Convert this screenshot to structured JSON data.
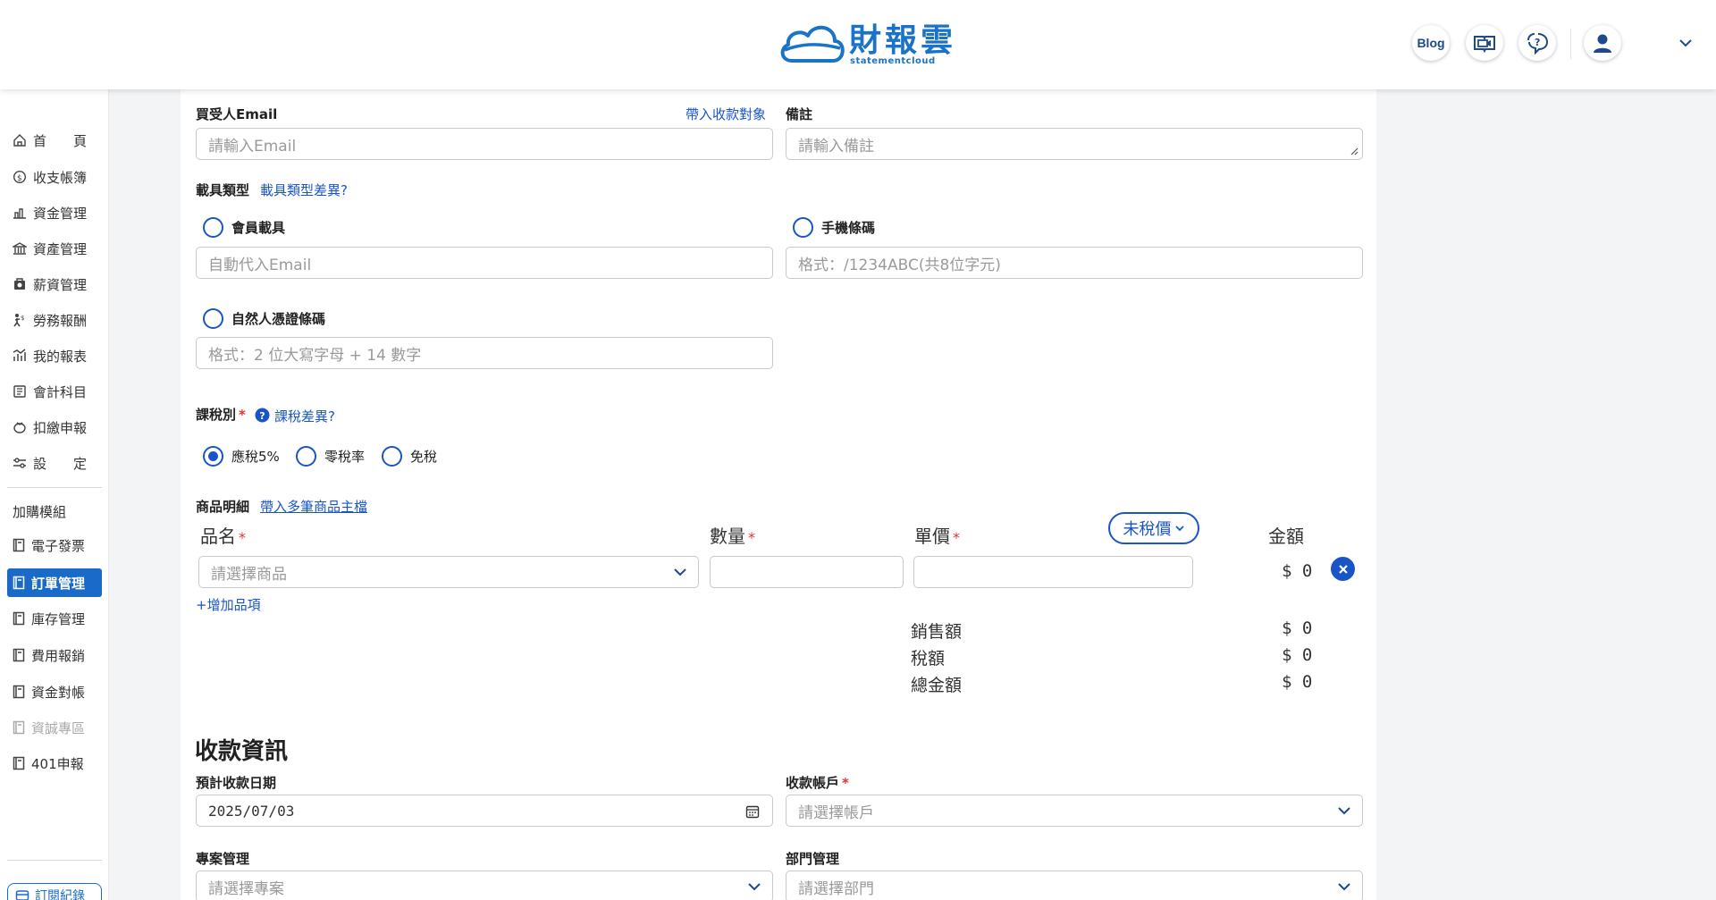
{
  "header": {
    "logo_title": "財報雲",
    "logo_subtitle": "statementcloud",
    "blog_label": "Blog",
    "icons": [
      "video-book-icon",
      "help-chat-icon",
      "user-avatar-icon",
      "chevron-down-icon"
    ]
  },
  "sidebar": {
    "items": [
      {
        "label": "首　　頁",
        "icon": "home-icon"
      },
      {
        "label": "收支帳簿",
        "icon": "money-circle-icon"
      },
      {
        "label": "資金管理",
        "icon": "fund-icon"
      },
      {
        "label": "資產管理",
        "icon": "bank-icon"
      },
      {
        "label": "薪資管理",
        "icon": "salary-icon"
      },
      {
        "label": "勞務報酬",
        "icon": "labor-icon"
      },
      {
        "label": "我的報表",
        "icon": "report-chart-icon"
      },
      {
        "label": "會計科目",
        "icon": "ledger-icon"
      },
      {
        "label": "扣繳申報",
        "icon": "tax-icon"
      },
      {
        "label": "設　　定",
        "icon": "settings-sliders-icon"
      }
    ],
    "addon_group_label": "加購模組",
    "addon_items": [
      {
        "label": "電子發票",
        "state": "normal"
      },
      {
        "label": "訂單管理",
        "state": "active"
      },
      {
        "label": "庫存管理",
        "state": "normal"
      },
      {
        "label": "費用報銷",
        "state": "normal"
      },
      {
        "label": "資金對帳",
        "state": "normal"
      },
      {
        "label": "資誠專區",
        "state": "disabled"
      },
      {
        "label": "401申報",
        "state": "normal"
      }
    ],
    "bottom_button_label": "訂閱紀錄"
  },
  "form": {
    "buyer_email_label": "買受人Email",
    "bring_payee_link": "帶入收款對象",
    "buyer_email_placeholder": "請輸入Email",
    "note_label": "備註",
    "note_placeholder": "請輸入備註",
    "carrier_type_label": "載具類型",
    "carrier_diff_link": "載具類型差異?",
    "carrier_member_label": "會員載具",
    "carrier_member_placeholder": "自動代入Email",
    "carrier_mobile_label": "手機條碼",
    "carrier_mobile_placeholder": "格式：/1234ABC(共8位字元)",
    "carrier_citizen_label": "自然人憑證條碼",
    "carrier_citizen_placeholder": "格式：2 位大寫字母 + 14 數字",
    "tax_type_label": "課稅別",
    "tax_diff_link": "課稅差異?",
    "tax_options": [
      {
        "label": "應稅5%",
        "selected": true
      },
      {
        "label": "零稅率",
        "selected": false
      },
      {
        "label": "免稅",
        "selected": false
      }
    ],
    "items_label": "商品明細",
    "items_import_link": "帶入多筆商品主檔",
    "col_name": "品名",
    "col_qty": "數量",
    "col_price": "單價",
    "col_amount": "金額",
    "price_mode": "未稅價",
    "product_placeholder": "請選擇商品",
    "row_amount": "$ 0",
    "add_item_link": "+增加品項",
    "summary": [
      {
        "label": "銷售額",
        "value": "$ 0"
      },
      {
        "label": "稅額",
        "value": "$ 0"
      },
      {
        "label": "總金額",
        "value": "$ 0"
      }
    ]
  },
  "payment": {
    "section_title": "收款資訊",
    "expected_date_label": "預計收款日期",
    "expected_date_value": "2025/07/03",
    "account_label": "收款帳戶",
    "account_placeholder": "請選擇帳戶",
    "project_label": "專案管理",
    "project_placeholder": "請選擇專案",
    "department_label": "部門管理",
    "department_placeholder": "請選擇部門"
  },
  "colors": {
    "brand_blue": "#1a6bc9",
    "link_blue": "#1a55c8",
    "required_red": "#e0342f"
  }
}
